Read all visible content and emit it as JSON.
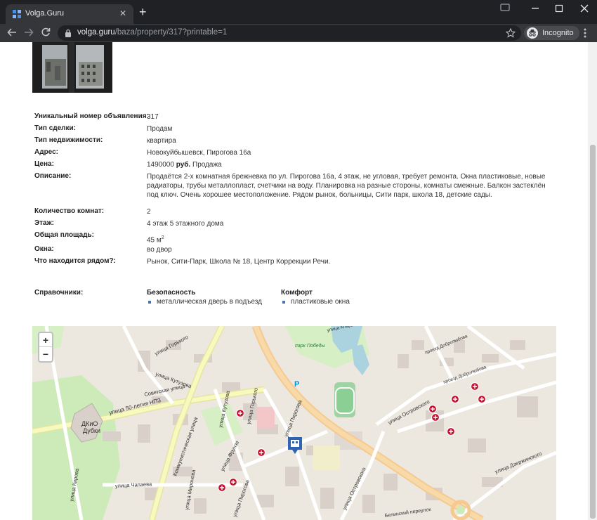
{
  "browser": {
    "tab_title": "Volga.Guru",
    "tab_close": "✕",
    "new_tab": "+",
    "url_host": "volga.guru",
    "url_path": "/baza/property/317?printable=1",
    "incognito_label": "Incognito"
  },
  "listing": {
    "rows": [
      {
        "label": "Уникальный номер объявления:",
        "value": "317"
      },
      {
        "label": "Тип сделки:",
        "value": "Продам"
      },
      {
        "label": "Тип недвижимости:",
        "value": "квартира"
      },
      {
        "label": "Адрес:",
        "value": "Новокуйбышевск, Пирогова 16а"
      },
      {
        "label": "Цена:",
        "value": "1490000",
        "currency": "руб.",
        "suffix": "Продажа"
      },
      {
        "label": "Описание:",
        "value": "Продаётся 2-х комнатная брежневка по ул. Пирогова 16а, 4 этаж, не угловая, требует ремонта. Окна пластиковые, новые радиаторы, трубы металлопласт, счетчики на воду. Планировка на разные стороны, комнаты смежные. Балкон застеклён под ключ. Очень хорошее местоположение. Рядом рынок, больницы, Сити парк, школа 18, детские сады."
      },
      {
        "label": "Количество комнат:",
        "value": "2"
      },
      {
        "label": "Этаж:",
        "value": "4 этаж 5 этажного дома"
      },
      {
        "label": "Общая площадь:",
        "value": "45 м",
        "sup": "2"
      },
      {
        "label": "Окна:",
        "value": "во двор"
      },
      {
        "label": "Что находится рядом?:",
        "value": "Рынок, Сити-Парк, Школа № 18, Центр Коррекции Речи."
      }
    ]
  },
  "references": {
    "title": "Справочники:",
    "groups": [
      {
        "heading": "Безопасность",
        "items": [
          "металлическая дверь в подъезд"
        ]
      },
      {
        "heading": "Комфорт",
        "items": [
          "пластиковые окна"
        ]
      }
    ]
  },
  "map": {
    "zoom_in": "+",
    "zoom_out": "−",
    "parking_letter": "P",
    "labels": {
      "gorkogo_top": "улица Горького",
      "kutuzova_a": "улица Кутузова",
      "sovetskaya": "Советская улица",
      "fiftyyears": "улица 50-летия НПЗ",
      "kommunisticheskaya": "Коммунистическая улица",
      "kutuzova_b": "улица Кутузова",
      "gorkogo_mid": "улица Горького",
      "pirogova_a": "улица Пирогова",
      "frunze": "улица Фрунзе",
      "dk_line1": "ДКиО",
      "dk_line2": "Дубки",
      "kirova": "улица Кирова",
      "chapaeva": "улица Чапаева",
      "mironova": "улица Миронова",
      "pirogova_b": "улица Пирогова",
      "ostrovskogo_a": "улица Островского",
      "ostrovskogo_b": "улица Островского",
      "dzerzhinskogo": "улица Дзержинского",
      "park": "парк Победы",
      "belinskogo": "Белинский переулок",
      "dobrolyubova_a": "проезд Добролюбова",
      "dobrolyubova_b": "проезд Добролюбова",
      "klary": "улица Клары Цеткин"
    }
  },
  "colors": {
    "chrome_dark": "#202124",
    "chrome_toolbar": "#35363a",
    "bullet": "#4a74b4",
    "map_bg": "#ece7df",
    "road_major": "#f7fabf",
    "road_orange": "#f6c990",
    "park": "#c8e6b5",
    "water": "#aad3df",
    "marker_red": "#c8102e"
  }
}
